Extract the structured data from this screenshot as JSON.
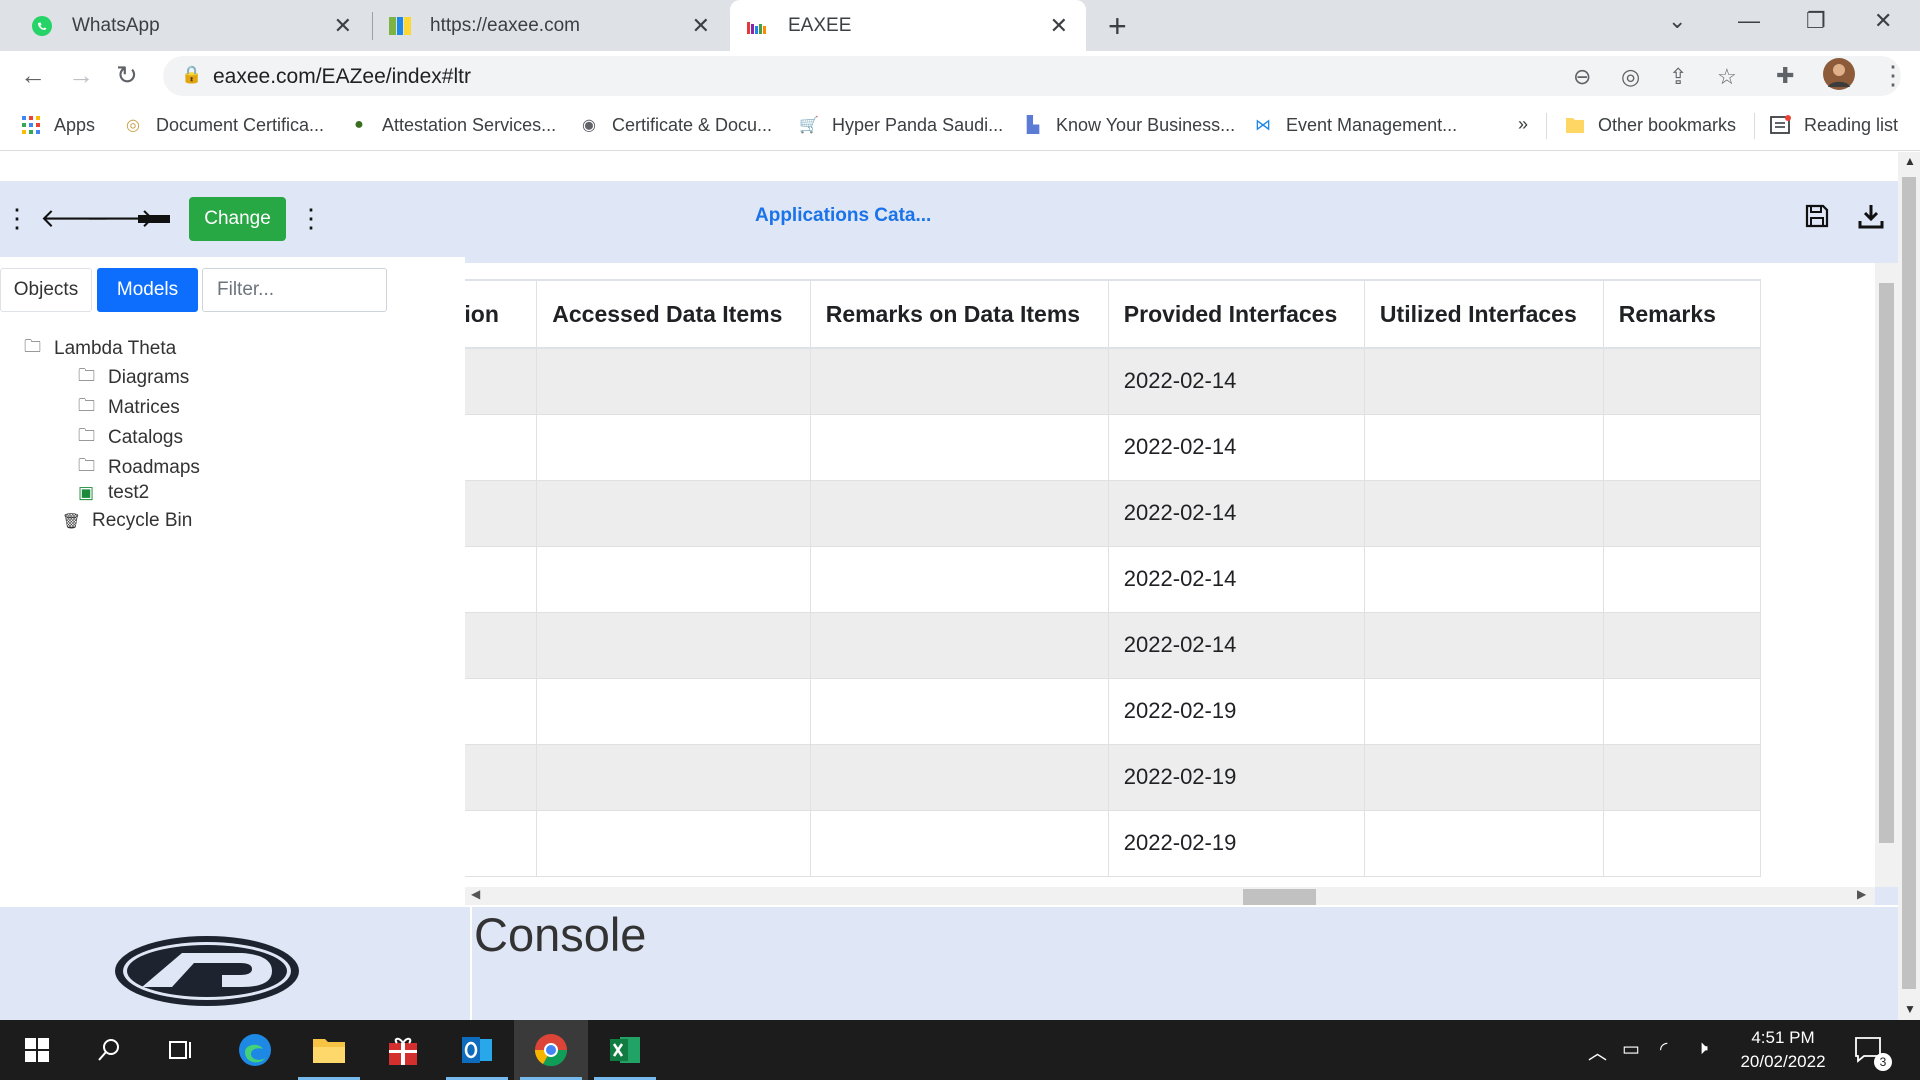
{
  "browser": {
    "tabs": [
      {
        "title": "WhatsApp",
        "icon": "whatsapp-icon"
      },
      {
        "title": "https://eaxee.com",
        "icon": "eaxee-icon"
      },
      {
        "title": "EAXEE",
        "icon": "eaxee-bars-icon"
      }
    ],
    "url": "eaxee.com/EAZee/index#ltr",
    "bookmarks": [
      {
        "label": "Apps"
      },
      {
        "label": "Document Certifica..."
      },
      {
        "label": "Attestation Services..."
      },
      {
        "label": "Certificate & Docu..."
      },
      {
        "label": "Hyper Panda Saudi..."
      },
      {
        "label": "Know Your Business..."
      },
      {
        "label": "Event Management..."
      }
    ],
    "more_bookmarks": "»",
    "other_bookmarks": "Other bookmarks",
    "reading_list": "Reading list"
  },
  "app": {
    "change_label": "Change",
    "title": "Applications Cata...",
    "tabs": {
      "objects": "Objects",
      "models": "Models"
    },
    "filter_placeholder": "Filter...",
    "tree": {
      "root": "Lambda Theta",
      "items": [
        "Diagrams",
        "Matrices",
        "Catalogs",
        "Roadmaps",
        "test2"
      ],
      "recycle": "Recycle Bin"
    },
    "grid": {
      "columns": [
        "Localization",
        "Accessed Data Items",
        "Remarks on Data Items",
        "Provided Interfaces",
        "Utilized Interfaces",
        "Remarks"
      ],
      "rows": [
        [
          "",
          "",
          "",
          "2022-02-14",
          "",
          ""
        ],
        [
          "",
          "",
          "",
          "2022-02-14",
          "",
          ""
        ],
        [
          "",
          "",
          "",
          "2022-02-14",
          "",
          ""
        ],
        [
          "",
          "",
          "",
          "2022-02-14",
          "",
          ""
        ],
        [
          "",
          "",
          "",
          "2022-02-14",
          "",
          ""
        ],
        [
          "",
          "",
          "",
          "2022-02-19",
          "",
          ""
        ],
        [
          "",
          "",
          "",
          "2022-02-19",
          "",
          ""
        ],
        [
          "",
          "",
          "",
          "2022-02-19",
          "",
          ""
        ]
      ]
    },
    "console_title": "Console"
  },
  "taskbar": {
    "time": "4:51 PM",
    "date": "20/02/2022",
    "notifications": "3"
  }
}
